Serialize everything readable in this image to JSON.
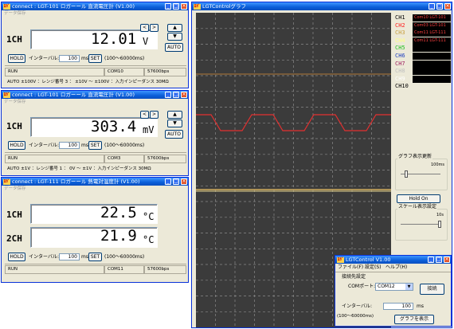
{
  "win1": {
    "title": "connect : LGT-101 ロガーール 直流電圧計 (V1.00)",
    "subtitle": "データ保存",
    "channel": "1CH",
    "value": "12.01",
    "unit": "V",
    "arrows": {
      "left": "<",
      "right": ">",
      "up": "▲",
      "down": "▼"
    },
    "auto": "AUTO",
    "hold": "HOLD",
    "interval_label": "インターバル:",
    "interval_value": "100",
    "interval_unit": "ms",
    "set": "SET",
    "interval_range": "(100〜60000ms)",
    "status": "RUN",
    "com": "COM10",
    "baud": "57600bps",
    "footer": "AUTO ±100V ：レンジ番号 3 ： ±10V 〜 ±100V ：入力インピーダンス 30MΩ"
  },
  "win2": {
    "title": "connect : LGT-101 ロガーール 直流電圧計 (V1.00)",
    "subtitle": "データ保存",
    "channel": "1CH",
    "value": "303.4",
    "unit": "mV",
    "arrows": {
      "left": "<",
      "right": ">",
      "up": "▲",
      "down": "▼"
    },
    "auto": "AUTO",
    "hold": "HOLD",
    "interval_label": "インターバル:",
    "interval_value": "100",
    "interval_unit": "ms",
    "set": "SET",
    "interval_range": "(100〜60000ms)",
    "status": "RUN",
    "com": "COM3",
    "baud": "57600bps",
    "footer": "AUTO ±1V ：レンジ番号 1 ： 0V 〜 ±1V ：入力インピーダンス 30MΩ"
  },
  "win3": {
    "title": "connect : LGT-111 ロガーール 熱電対温度計 (V1.00)",
    "subtitle": "データ保存",
    "ch1": "1CH",
    "value1": "22.5",
    "ch2": "2CH",
    "value2": "21.9",
    "unit": "°C",
    "hold": "HOLD",
    "interval_label": "インターバル:",
    "interval_value": "100",
    "interval_unit": "ms",
    "set": "SET",
    "interval_range": "(100〜60000ms)",
    "status": "RUN",
    "com": "COM11",
    "baud": "57600bps"
  },
  "graph": {
    "title": "LGTControlグラフ",
    "channels": [
      {
        "label": "CH1",
        "color": "#000000",
        "tag": "Com10 LGT-101"
      },
      {
        "label": "CH2",
        "color": "#ff2020",
        "tag": "Com03 LGT-101"
      },
      {
        "label": "CH3",
        "color": "#c8a040",
        "tag": "Com11 LGT-111"
      },
      {
        "label": "CH4",
        "color": "#ffff80",
        "tag": "Com11 LGT-111"
      },
      {
        "label": "CH5",
        "color": "#20c020",
        "tag": ""
      },
      {
        "label": "CH6",
        "color": "#2040c0",
        "tag": ""
      },
      {
        "label": "CH7",
        "color": "#a02060",
        "tag": ""
      },
      {
        "label": "CH8",
        "color": "#c0c0c0",
        "tag": ""
      },
      {
        "label": "CH9",
        "color": "#ffffff",
        "tag": ""
      },
      {
        "label": "CH10",
        "color": "#000000",
        "tag": ""
      }
    ],
    "update_label": "グラフ表示更新",
    "update_value": "100ms",
    "hold_on": "Hold On",
    "scale_label": "スケール表示設定",
    "scale_value": "10s"
  },
  "control": {
    "title": "LGTControl V1.00",
    "menu": [
      "ファイル(F)",
      "設定(S)",
      "ヘルプ(H)"
    ],
    "section": "接続先設定",
    "com_label": "COMポート:",
    "com_value": "COM12",
    "connect": "接続",
    "interval_label": "インターバル:",
    "interval_value": "100",
    "interval_unit": "ms",
    "interval_range": "(100〜60000ms)",
    "show_graph": "グラフを表示"
  }
}
